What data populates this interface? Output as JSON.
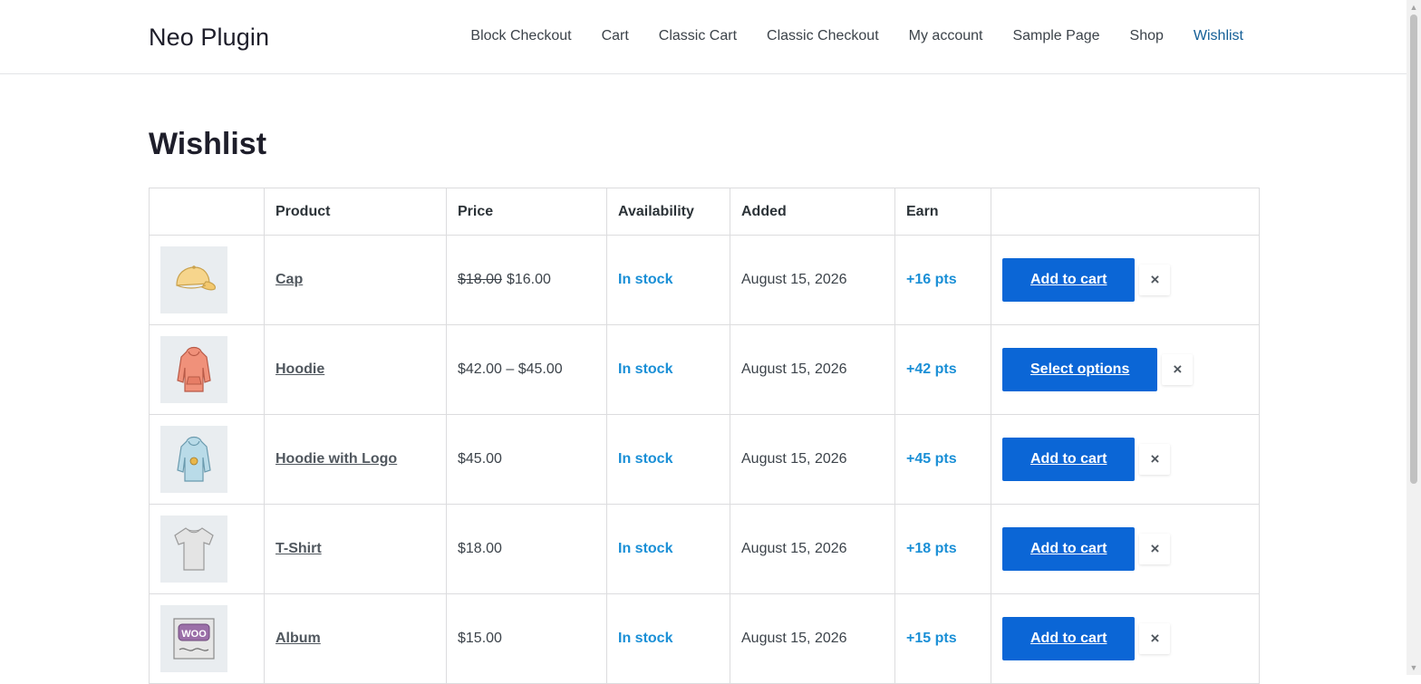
{
  "site": {
    "title": "Neo Plugin"
  },
  "nav": {
    "items": [
      {
        "label": "Block Checkout"
      },
      {
        "label": "Cart"
      },
      {
        "label": "Classic Cart"
      },
      {
        "label": "Classic Checkout"
      },
      {
        "label": "My account"
      },
      {
        "label": "Sample Page"
      },
      {
        "label": "Shop"
      },
      {
        "label": "Wishlist",
        "active": true
      }
    ]
  },
  "page": {
    "title": "Wishlist"
  },
  "table": {
    "headers": [
      "",
      "Product",
      "Price",
      "Availability",
      "Added",
      "Earn",
      ""
    ],
    "rows": [
      {
        "image_icon": "cap-icon",
        "product": "Cap",
        "old_price": "$18.00",
        "price": "$16.00",
        "availability": "In stock",
        "added": "August 15, 2026",
        "earn": "+16 pts",
        "action": "Add to cart",
        "remove": "×"
      },
      {
        "image_icon": "hoodie-icon",
        "product": "Hoodie",
        "old_price": "",
        "price": "$42.00 – $45.00",
        "availability": "In stock",
        "added": "August 15, 2026",
        "earn": "+42 pts",
        "action": "Select options",
        "remove": "×"
      },
      {
        "image_icon": "hoodie-with-logo-icon",
        "product": "Hoodie with Logo",
        "old_price": "",
        "price": "$45.00",
        "availability": "In stock",
        "added": "August 15, 2026",
        "earn": "+45 pts",
        "action": "Add to cart",
        "remove": "×"
      },
      {
        "image_icon": "tshirt-icon",
        "product": "T-Shirt",
        "old_price": "",
        "price": "$18.00",
        "availability": "In stock",
        "added": "August 15, 2026",
        "earn": "+18 pts",
        "action": "Add to cart",
        "remove": "×"
      },
      {
        "image_icon": "album-icon",
        "product": "Album",
        "old_price": "",
        "price": "$15.00",
        "availability": "In stock",
        "added": "August 15, 2026",
        "earn": "+15 pts",
        "action": "Add to cart",
        "remove": "×"
      }
    ]
  },
  "colors": {
    "accent": "#0b66d6",
    "stock": "#1a8fd6",
    "nav_active": "#135e96"
  }
}
